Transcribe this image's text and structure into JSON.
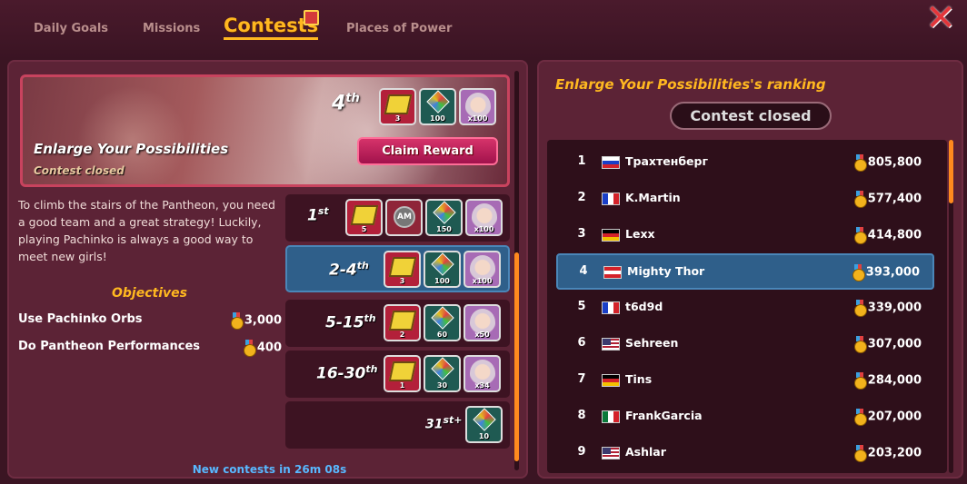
{
  "tabs": [
    {
      "label": "Daily Goals"
    },
    {
      "label": "Missions"
    },
    {
      "label": "Contests"
    },
    {
      "label": "Places of Power"
    }
  ],
  "contest": {
    "title": "Enlarge Your Possibilities",
    "status": "Contest closed",
    "my_rank": "4",
    "my_rank_suffix": "th",
    "claim_label": "Claim Reward",
    "my_rewards": [
      "3",
      "100",
      "x100"
    ],
    "description": "To climb the stairs of the Pantheon, you need a good team and a great strategy! Luckily, playing Pachinko is always a good way to meet new girls!",
    "objectives_title": "Objectives",
    "objectives": [
      {
        "label": "Use Pachinko Orbs",
        "points": "3,000"
      },
      {
        "label": "Do Pantheon Performances",
        "points": "400"
      }
    ],
    "tiers": [
      {
        "place": "1",
        "suffix": "st",
        "rewards": [
          "5",
          "AM",
          "150",
          "x100"
        ]
      },
      {
        "place": "2-4",
        "suffix": "th",
        "rewards": [
          "3",
          "100",
          "x100"
        ]
      },
      {
        "place": "5-15",
        "suffix": "th",
        "rewards": [
          "2",
          "60",
          "x50"
        ]
      },
      {
        "place": "16-30",
        "suffix": "th",
        "rewards": [
          "1",
          "30",
          "x34"
        ]
      },
      {
        "place": "31",
        "suffix": "st+",
        "rewards": [
          "10"
        ]
      }
    ],
    "timer": "New contests in 26m 08s"
  },
  "ranking": {
    "title": "Enlarge Your Possibilities's ranking",
    "status": "Contest closed",
    "rows": [
      {
        "pos": "1",
        "flag": "ru",
        "name": "Трахтенберг",
        "score": "805,800"
      },
      {
        "pos": "2",
        "flag": "fr",
        "name": "K.Martin",
        "score": "577,400"
      },
      {
        "pos": "3",
        "flag": "de",
        "name": "Lexx",
        "score": "414,800"
      },
      {
        "pos": "4",
        "flag": "at",
        "name": "Mighty Thor",
        "score": "393,000"
      },
      {
        "pos": "5",
        "flag": "fr",
        "name": "t6d9d",
        "score": "339,000"
      },
      {
        "pos": "6",
        "flag": "us",
        "name": "Sehreen",
        "score": "307,000"
      },
      {
        "pos": "7",
        "flag": "de",
        "name": "Tins",
        "score": "284,000"
      },
      {
        "pos": "8",
        "flag": "mx",
        "name": "FrankGarcia",
        "score": "207,000"
      },
      {
        "pos": "9",
        "flag": "us",
        "name": "Ashlar",
        "score": "203,200"
      }
    ]
  },
  "colors": {
    "accent": "#ffb820",
    "highlight": "#2f5f8a",
    "panel": "#5c2336"
  }
}
